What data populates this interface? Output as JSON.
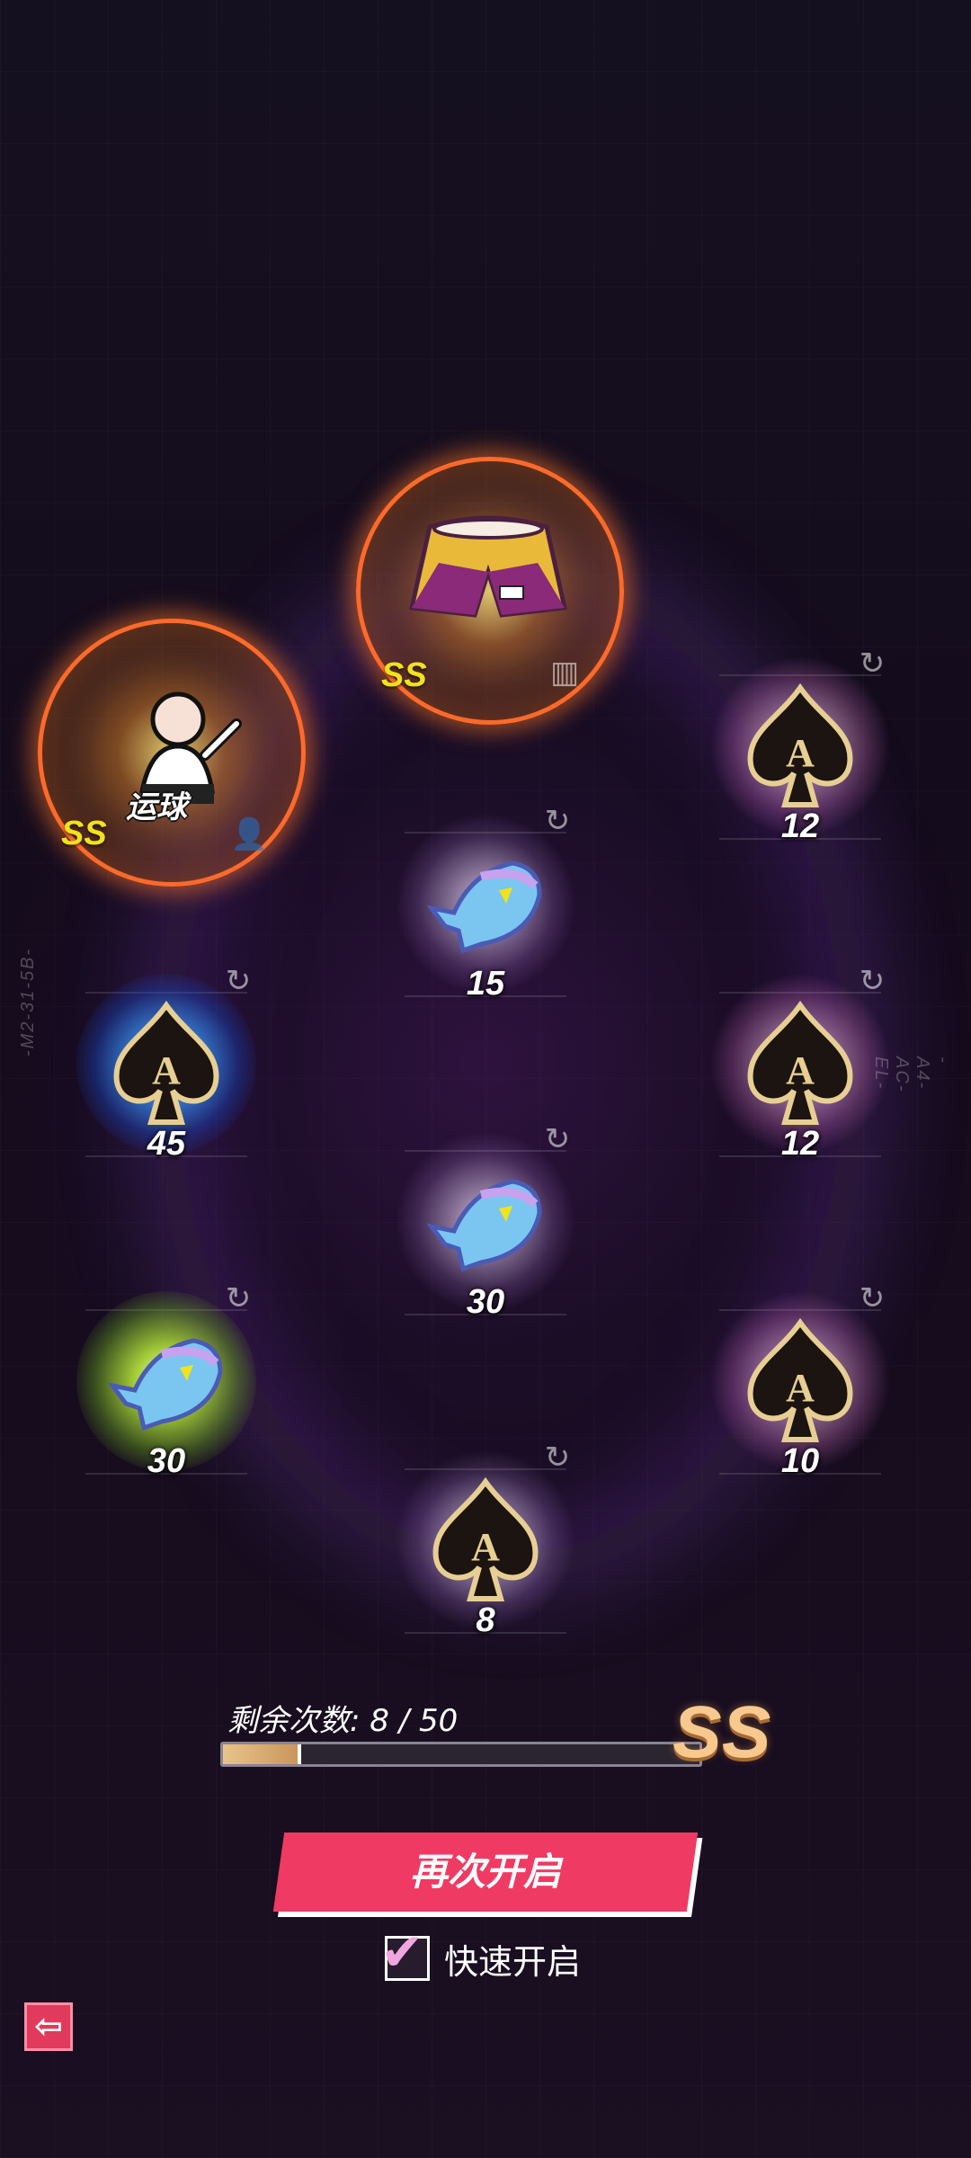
{
  "side_codes": {
    "left": "-M2-31-5B-",
    "right": "-A4-AC-EL-"
  },
  "featured": [
    {
      "grade": "SS",
      "chip_text": "运球",
      "icon": "character-dribble-icon",
      "mini_icon": "person-icon"
    },
    {
      "grade": "SS",
      "icon": "shorts-icon",
      "mini_icon": "shorts-small-icon"
    }
  ],
  "rewards": [
    {
      "icon": "ace-spade-icon",
      "count": "12"
    },
    {
      "icon": "fish-icon",
      "count": "15"
    },
    {
      "icon": "ace-spade-icon",
      "count": "45"
    },
    {
      "icon": "ace-spade-icon",
      "count": "12"
    },
    {
      "icon": "fish-icon",
      "count": "30"
    },
    {
      "icon": "fish-icon",
      "count": "30"
    },
    {
      "icon": "ace-spade-icon",
      "count": "10"
    },
    {
      "icon": "ace-spade-icon",
      "count": "8"
    }
  ],
  "remaining": {
    "label": "剩余次数: 8 / 50",
    "used": 8,
    "total": 50,
    "grade": "SS"
  },
  "open_again_label": "再次开启",
  "quick_open": {
    "label": "快速开启",
    "checked": true
  },
  "back_icon": "back-arrow-icon",
  "colors": {
    "accent": "#ef3a63",
    "ss_yellow": "#f2e21a",
    "ss_ring": "#ff6a2a"
  }
}
